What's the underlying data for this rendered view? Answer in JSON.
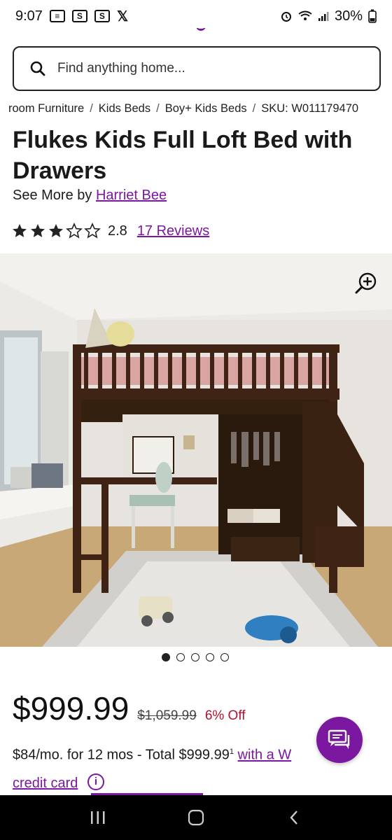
{
  "status_bar": {
    "time": "9:07",
    "battery": "30%"
  },
  "search": {
    "placeholder": "Find anything home..."
  },
  "breadcrumb": [
    "room Furniture",
    "Kids Beds",
    "Boy+ Kids Beds",
    "SKU: W011179470"
  ],
  "breadcrumb_sep": "/",
  "product": {
    "title": "Flukes Kids Full Loft Bed with Drawers",
    "see_more_prefix": "See More by",
    "brand": "Harriet Bee",
    "rating": 2.8,
    "rating_text": "2.8",
    "stars_filled": 3,
    "stars_total": 5,
    "reviews_label": "17 Reviews"
  },
  "gallery": {
    "image_count": 5,
    "active_index": 0
  },
  "pricing": {
    "price": "$999.99",
    "was_price": "$1,059.99",
    "discount": "6% Off",
    "financing_text": "$84/mo. for 12 mos - Total $999.99",
    "financing_sup": "1",
    "financing_link": "with a W",
    "financing_link_2": "credit card"
  },
  "colors": {
    "accent": "#7b189f",
    "discount": "#b0122e"
  },
  "icons": [
    "search-icon",
    "zoom-in-icon",
    "info-icon",
    "chat-icon",
    "recent-apps-icon",
    "home-icon",
    "back-icon"
  ]
}
